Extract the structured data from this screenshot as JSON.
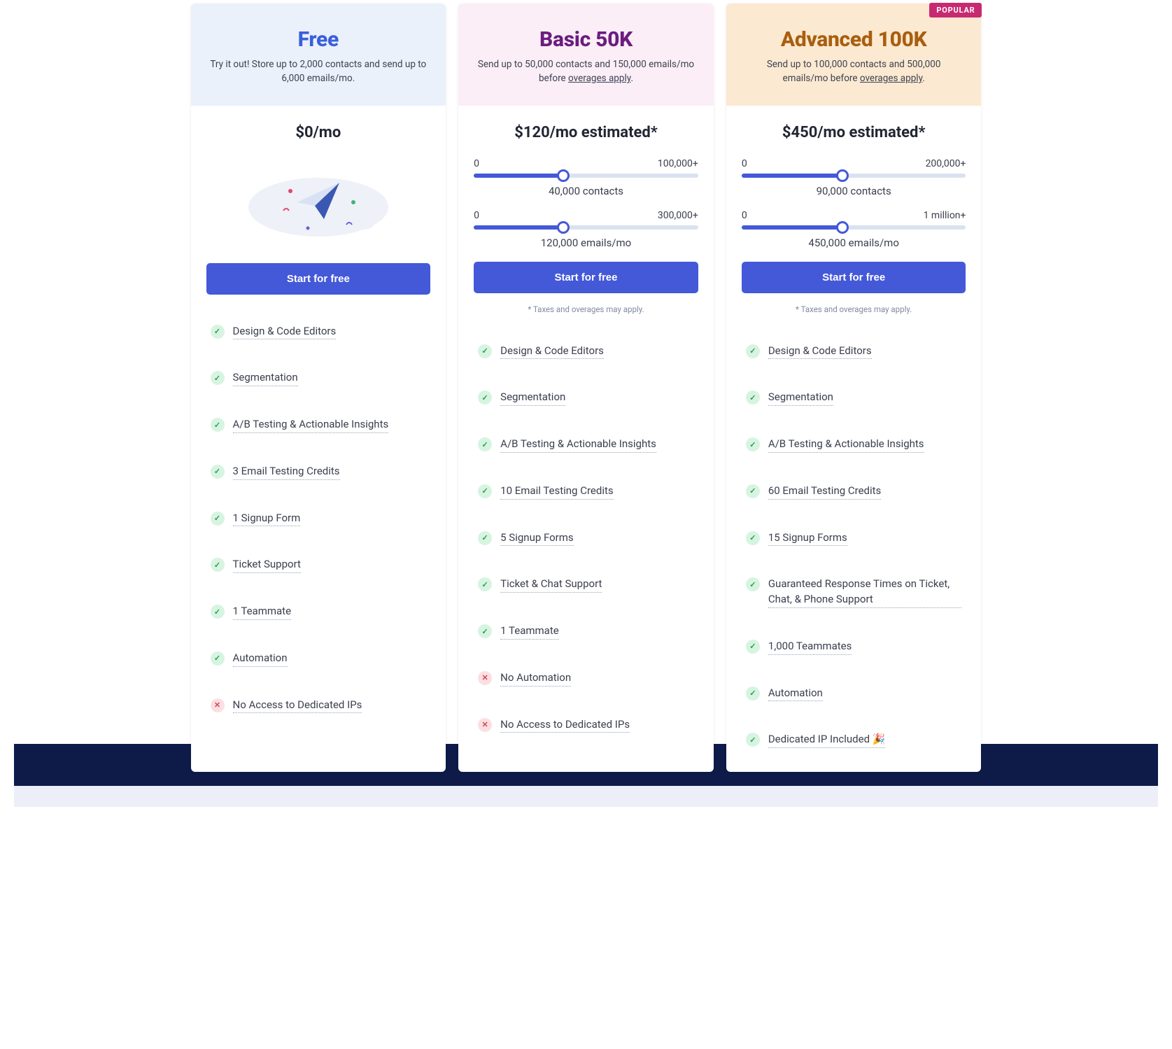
{
  "popular_label": "POPULAR",
  "cta": "Start for free",
  "tax_note": "* Taxes and overages may apply.",
  "overages_link": "overages apply",
  "plans": {
    "free": {
      "title": "Free",
      "subtitle_a": "Try it out! Store up to 2,000 contacts and send up to 6,000 emails/mo.",
      "price": "$0/mo",
      "features": [
        {
          "ok": true,
          "label": "Design & Code Editors"
        },
        {
          "ok": true,
          "label": "Segmentation"
        },
        {
          "ok": true,
          "label": "A/B Testing & Actionable Insights"
        },
        {
          "ok": true,
          "label": "3 Email Testing Credits"
        },
        {
          "ok": true,
          "label": "1 Signup Form"
        },
        {
          "ok": true,
          "label": "Ticket Support"
        },
        {
          "ok": true,
          "label": "1 Teammate"
        },
        {
          "ok": true,
          "label": "Automation"
        },
        {
          "ok": false,
          "label": "No Access to Dedicated IPs"
        }
      ]
    },
    "basic": {
      "title": "Basic 50K",
      "subtitle_a": "Send up to 50,000 contacts and 150,000 emails/mo before ",
      "subtitle_b": ".",
      "price": "$120/mo estimated*",
      "contacts": {
        "min": "0",
        "max": "100,000+",
        "value": "40,000 contacts",
        "pct": 40
      },
      "emails": {
        "min": "0",
        "max": "300,000+",
        "value": "120,000 emails/mo",
        "pct": 40
      },
      "features": [
        {
          "ok": true,
          "label": "Design & Code Editors"
        },
        {
          "ok": true,
          "label": "Segmentation"
        },
        {
          "ok": true,
          "label": "A/B Testing & Actionable Insights"
        },
        {
          "ok": true,
          "label": "10 Email Testing Credits"
        },
        {
          "ok": true,
          "label": "5 Signup Forms"
        },
        {
          "ok": true,
          "label": "Ticket & Chat Support"
        },
        {
          "ok": true,
          "label": "1 Teammate"
        },
        {
          "ok": false,
          "label": "No Automation"
        },
        {
          "ok": false,
          "label": "No Access to Dedicated IPs"
        }
      ]
    },
    "advanced": {
      "title": "Advanced 100K",
      "subtitle_a": "Send up to 100,000 contacts and 500,000 emails/mo before ",
      "subtitle_b": ".",
      "price": "$450/mo estimated*",
      "contacts": {
        "min": "0",
        "max": "200,000+",
        "value": "90,000 contacts",
        "pct": 45
      },
      "emails": {
        "min": "0",
        "max": "1 million+",
        "value": "450,000 emails/mo",
        "pct": 45
      },
      "features": [
        {
          "ok": true,
          "label": "Design & Code Editors"
        },
        {
          "ok": true,
          "label": "Segmentation"
        },
        {
          "ok": true,
          "label": "A/B Testing & Actionable Insights"
        },
        {
          "ok": true,
          "label": "60 Email Testing Credits"
        },
        {
          "ok": true,
          "label": "15 Signup Forms"
        },
        {
          "ok": true,
          "label": "Guaranteed Response Times on Ticket, Chat, & Phone Support"
        },
        {
          "ok": true,
          "label": "1,000 Teammates"
        },
        {
          "ok": true,
          "label": "Automation"
        },
        {
          "ok": true,
          "label": "Dedicated IP Included 🎉"
        }
      ]
    }
  }
}
